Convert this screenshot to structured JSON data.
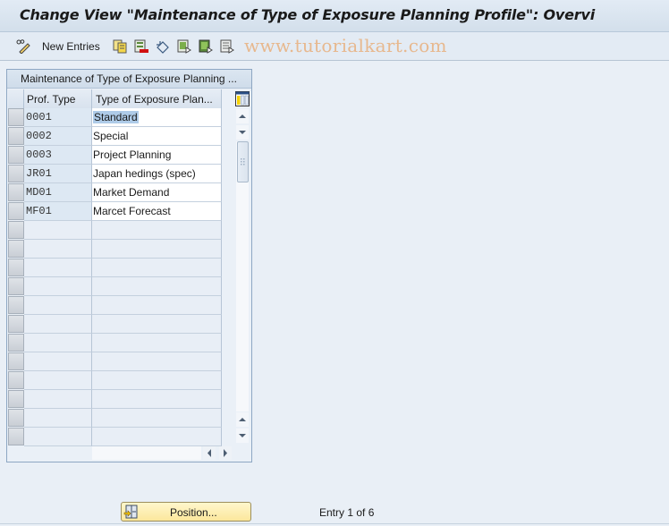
{
  "window": {
    "title": "Change View \"Maintenance of Type of Exposure Planning Profile\": Overvi"
  },
  "toolbar": {
    "items": [
      {
        "icon": "pencil-glasses-icon",
        "label": ""
      },
      {
        "icon": "new-entries",
        "label": "New Entries"
      },
      {
        "icon": "copy-as-icon",
        "label": ""
      },
      {
        "icon": "delete-icon",
        "label": ""
      },
      {
        "icon": "undo-change-icon",
        "label": ""
      },
      {
        "icon": "select-all-icon",
        "label": ""
      },
      {
        "icon": "select-block-icon",
        "label": ""
      },
      {
        "icon": "deselect-all-icon",
        "label": ""
      }
    ],
    "new_entries_label": "New Entries",
    "watermark": "www.tutorialkart.com"
  },
  "table": {
    "caption": "Maintenance of Type of Exposure Planning ...",
    "columns": [
      {
        "key": "prof_type",
        "label": "Prof. Type"
      },
      {
        "key": "description",
        "label": "Type of Exposure Plan..."
      }
    ],
    "rows": [
      {
        "prof_type": "0001",
        "description": "Standard",
        "selected": true
      },
      {
        "prof_type": "0002",
        "description": "Special"
      },
      {
        "prof_type": "0003",
        "description": "Project Planning"
      },
      {
        "prof_type": "JR01",
        "description": "Japan hedings (spec)"
      },
      {
        "prof_type": "MD01",
        "description": "Market Demand"
      },
      {
        "prof_type": "MF01",
        "description": "Marcet Forecast"
      }
    ],
    "empty_row_count": 12,
    "column_settings_icon": "table-settings-icon"
  },
  "footer": {
    "position_button_label": "Position...",
    "entry_info": "Entry 1 of 6"
  },
  "colors": {
    "background": "#e9eff6",
    "watermark": "#e7b88e",
    "position_button": "#fbe79c",
    "selection": "#aecbe8"
  }
}
